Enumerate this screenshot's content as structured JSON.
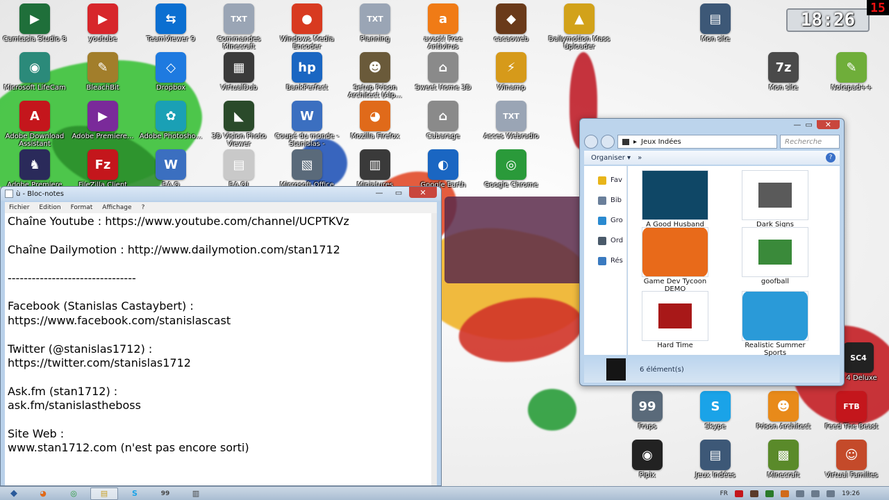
{
  "desktop": {
    "icons": [
      {
        "label": "Camtasia Studio 8",
        "glyph": "▶",
        "color": "#1f6f3a"
      },
      {
        "label": "youtube",
        "glyph": "▶",
        "color": "#d7262b"
      },
      {
        "label": "TeamViewer 9",
        "glyph": "⇆",
        "color": "#0b6fd1"
      },
      {
        "label": "Commandes Minecraft",
        "glyph": "TXT",
        "color": "#9aa5b5"
      },
      {
        "label": "Windows Media Encoder",
        "glyph": "●",
        "color": "#d83a20"
      },
      {
        "label": "Planning",
        "glyph": "TXT",
        "color": "#9aa5b5"
      },
      {
        "label": "avast! Free Antivirus",
        "glyph": "a",
        "color": "#f07b16"
      },
      {
        "label": "cacaoweb",
        "glyph": "◆",
        "color": "#6a3a1a"
      },
      {
        "label": "Dailymotion Mass Uploader",
        "glyph": "▲",
        "color": "#d2a21a"
      },
      {
        "label": "Mon site",
        "glyph": "▤",
        "color": "#3d5877"
      },
      {
        "label": "Microsoft LifeCam",
        "glyph": "◉",
        "color": "#2b8a7a"
      },
      {
        "label": "BleachBit",
        "glyph": "✎",
        "color": "#a27e2b"
      },
      {
        "label": "Dropbox",
        "glyph": "◇",
        "color": "#1e7ae0"
      },
      {
        "label": "VirtualDub",
        "glyph": "▦",
        "color": "#3a3a3a"
      },
      {
        "label": "BankPerfect",
        "glyph": "hp",
        "color": "#1a66c2"
      },
      {
        "label": "Setup Prison Architect (Alp...",
        "glyph": "☻",
        "color": "#6a5a3a"
      },
      {
        "label": "Sweet Home 3D",
        "glyph": "⌂",
        "color": "#8a8a8a"
      },
      {
        "label": "Winamp",
        "glyph": "⚡",
        "color": "#d69a1a"
      },
      {
        "label": "Mon site",
        "glyph": "7z",
        "color": "#4a4a4a"
      },
      {
        "label": "Notepad++",
        "glyph": "✎",
        "color": "#6fae3a"
      },
      {
        "label": "Adobe Download Assistant",
        "glyph": "A",
        "color": "#c4161c"
      },
      {
        "label": "Adobe Premiere...",
        "glyph": "▶",
        "color": "#7a2a9a"
      },
      {
        "label": "Adobe Photosho...",
        "glyph": "✿",
        "color": "#1aa0b5"
      },
      {
        "label": "3D Vision Photo Viewer",
        "glyph": "◣",
        "color": "#2a4a2a"
      },
      {
        "label": "Coupé du monde - Stanislas -",
        "glyph": "W",
        "color": "#3b6fc0"
      },
      {
        "label": "Mozilla Firefox",
        "glyph": "◕",
        "color": "#e06a1a"
      },
      {
        "label": "Cabarage",
        "glyph": "⌂",
        "color": "#8a8a8a"
      },
      {
        "label": "Acces Webradio",
        "glyph": "TXT",
        "color": "#9aa5b5"
      },
      {
        "label": "Adobe Premiere Pro",
        "glyph": "♞",
        "color": "#2a2a5a"
      },
      {
        "label": "FileZilla Client",
        "glyph": "Fz",
        "color": "#c4161c"
      },
      {
        "label": "F.A.Q",
        "glyph": "W",
        "color": "#3b6fc0"
      },
      {
        "label": "F.A.Q!",
        "glyph": "▤",
        "color": "#c9c9c9"
      },
      {
        "label": "Microsoft Office",
        "glyph": "▧",
        "color": "#5a6a7a"
      },
      {
        "label": "Miniatures",
        "glyph": "▥",
        "color": "#3a3a3a"
      },
      {
        "label": "Google Earth",
        "glyph": "◐",
        "color": "#1a66c2"
      },
      {
        "label": "Google Chrome",
        "glyph": "◎",
        "color": "#2a9a3a"
      },
      {
        "label": "Fraps",
        "glyph": "99",
        "color": "#5a6a7a"
      },
      {
        "label": "Skype",
        "glyph": "S",
        "color": "#1aa3e8"
      },
      {
        "label": "Prison Architect",
        "glyph": "☻",
        "color": "#e88a1a"
      },
      {
        "label": "Feed The Beast",
        "glyph": "FTB",
        "color": "#c4161c"
      },
      {
        "label": "Pipix",
        "glyph": "◉",
        "color": "#222222"
      },
      {
        "label": "Jeux Indées",
        "glyph": "▤",
        "color": "#3d5877"
      },
      {
        "label": "Minecraft",
        "glyph": "▩",
        "color": "#5a8a2a"
      },
      {
        "label": "Virtual Families",
        "glyph": "☺",
        "color": "#c44a2a"
      },
      {
        "label": "y 4 Deluxe",
        "glyph": "SC4",
        "color": "#222222"
      }
    ]
  },
  "clock": {
    "time": "18:26",
    "fps": "15"
  },
  "notepad": {
    "title": "ù - Bloc-notes",
    "menu": [
      "Fichier",
      "Edition",
      "Format",
      "Affichage",
      "?"
    ],
    "lines": [
      "Chaîne Youtube : https://www.youtube.com/channel/UCPTKVz",
      "",
      "Chaîne Dailymotion : http://www.dailymotion.com/stan1712",
      "",
      "--------------------------------",
      "",
      "Facebook (Stanislas Castaybert) :",
      "https://www.facebook.com/stanislascast",
      "",
      "Twitter (@stanislas1712) :",
      "https://twitter.com/stanislas1712",
      "",
      "Ask.fm (stan1712) :",
      "ask.fm/stanislastheboss",
      "",
      "Site Web :",
      "www.stan1712.com (n'est pas encore sorti)"
    ]
  },
  "explorer": {
    "address": "Jeux Indées",
    "search_placeholder": "Recherche",
    "organize": "Organiser",
    "more": "»",
    "help": "?",
    "sidebar": [
      "Fav",
      "Bib",
      "Gro",
      "Ord",
      "Rés"
    ],
    "items": [
      {
        "label": "A Good Husband",
        "thumb": "#0f4766"
      },
      {
        "label": "Dark Signs",
        "thumb": "#5a5a5a"
      },
      {
        "label": "Game Dev Tycoon DEMO",
        "thumb": "#e86a1a"
      },
      {
        "label": "goofball",
        "thumb": "#3a8a3a"
      },
      {
        "label": "Hard Time",
        "thumb": "#a81818"
      },
      {
        "label": "Realistic Summer Sports",
        "thumb": "#2a9ad8"
      }
    ],
    "status": "6 élément(s)"
  },
  "taskbar": {
    "start": "◆",
    "buttons": [
      "◕",
      "◎",
      "▤",
      "S",
      "99",
      "▥"
    ],
    "lang": "FR",
    "time": "19:26"
  }
}
